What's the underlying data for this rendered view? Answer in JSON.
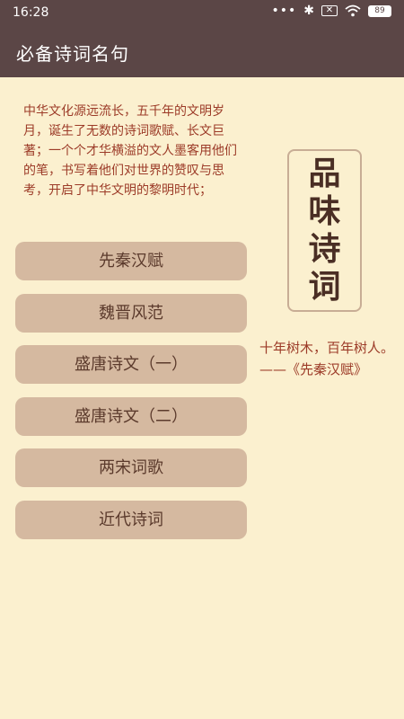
{
  "status": {
    "time": "16:28",
    "dots": "•••",
    "battery": "89"
  },
  "app": {
    "title": "必备诗词名句"
  },
  "intro": "中华文化源远流长，五千年的文明岁月，诞生了无数的诗词歌赋、长文巨著；一个个才华横溢的文人墨客用他们的笔，书写着他们对世界的赞叹与思考，开启了中华文明的黎明时代；",
  "menu": [
    {
      "label": "先秦汉赋"
    },
    {
      "label": "魏晋风范"
    },
    {
      "label": "盛唐诗文（一）"
    },
    {
      "label": "盛唐诗文（二）"
    },
    {
      "label": "两宋词歌"
    },
    {
      "label": "近代诗词"
    }
  ],
  "stamp": [
    "品",
    "味",
    "诗",
    "词"
  ],
  "quote": "十年树木，百年树人。——《先秦汉赋》",
  "colors": {
    "appbar": "#5b4646",
    "background": "#fbf0cf",
    "button": "#d5b9a0",
    "accent_text": "#9c3b28"
  }
}
